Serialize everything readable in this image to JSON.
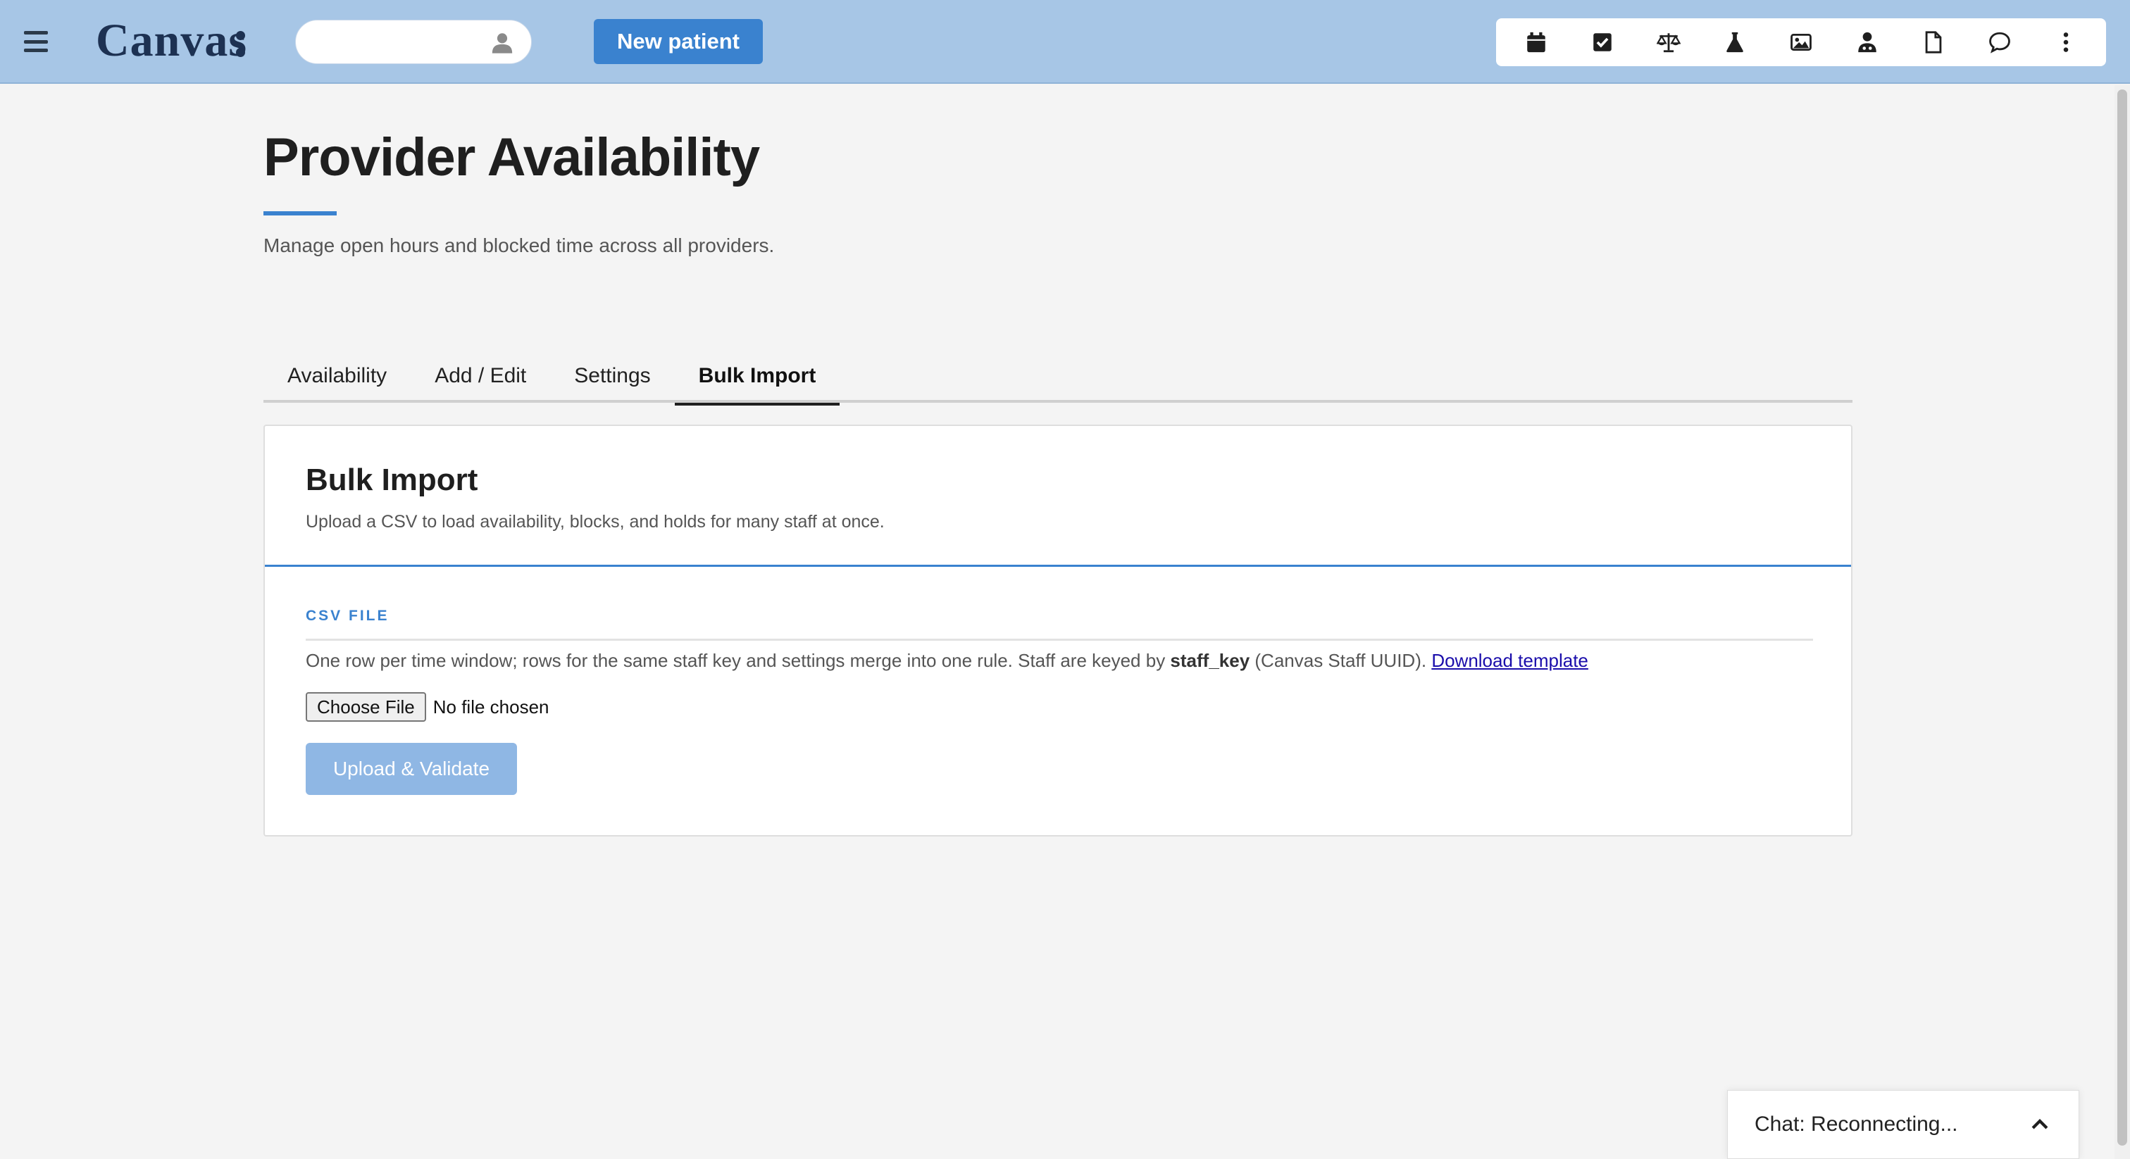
{
  "header": {
    "logo_text": "Canvas",
    "search_placeholder": "",
    "new_patient_label": "New patient"
  },
  "toolbar": {
    "icons": [
      "calendar-icon",
      "checkbox-icon",
      "scales-icon",
      "flask-icon",
      "image-icon",
      "staff-icon",
      "document-icon",
      "chat-bubble-icon",
      "more-vertical-icon"
    ]
  },
  "page": {
    "title": "Provider Availability",
    "subtitle": "Manage open hours and blocked time across all providers."
  },
  "tabs": [
    {
      "label": "Availability",
      "active": false
    },
    {
      "label": "Add / Edit",
      "active": false
    },
    {
      "label": "Settings",
      "active": false
    },
    {
      "label": "Bulk Import",
      "active": true
    }
  ],
  "card": {
    "title": "Bulk Import",
    "description": "Upload a CSV to load availability, blocks, and holds for many staff at once.",
    "section_label": "CSV FILE",
    "help_prefix": "One row per time window; rows for the same staff key and settings merge into one rule. Staff are keyed by ",
    "help_key": "staff_key",
    "help_suffix": " (Canvas Staff UUID). ",
    "template_link": "Download template",
    "choose_file_label": "Choose File",
    "file_status": "No file chosen",
    "upload_label": "Upload & Validate"
  },
  "chat": {
    "label": "Chat: Reconnecting..."
  },
  "colors": {
    "topbar": "#a7c6e6",
    "accent": "#3a82cf",
    "upload_disabled": "#8fb7e4"
  }
}
